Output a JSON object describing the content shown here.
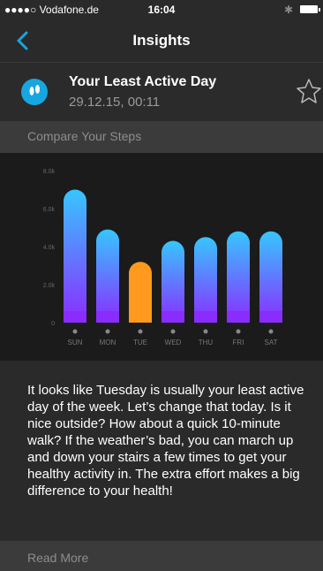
{
  "status_bar": {
    "carrier": "●●●●○ Vodafone.de",
    "time": "16:04"
  },
  "nav": {
    "title": "Insights"
  },
  "insight": {
    "title": "Your Least Active Day",
    "date": "29.12.15, 00:11"
  },
  "section": {
    "compare_label": "Compare Your Steps",
    "read_more_label": "Read More"
  },
  "body_text": "It looks like Tuesday is usually your least active day of the week. Let’s change that today. Is it nice outside? How about a quick 10-minute walk? If the weather’s bad, you can march up and down your stairs a few times to get your healthy activity in. The extra effort makes a big difference to your health!",
  "colors": {
    "accent": "#17a6e0",
    "bar_top": "#37c6ff",
    "bar_bottom": "#8b2cff",
    "highlight_bar": "#ff9a1f"
  },
  "chart_data": {
    "type": "bar",
    "categories": [
      "SUN",
      "MON",
      "TUE",
      "WED",
      "THU",
      "FRI",
      "SAT"
    ],
    "values": [
      7000,
      4900,
      3200,
      4300,
      4500,
      4800,
      4800
    ],
    "y_ticks": [
      "0",
      "2.0k",
      "4.0k",
      "6.0k",
      "8.0k"
    ],
    "ylim": [
      0,
      8000
    ],
    "highlight": "TUE",
    "grid": false
  }
}
